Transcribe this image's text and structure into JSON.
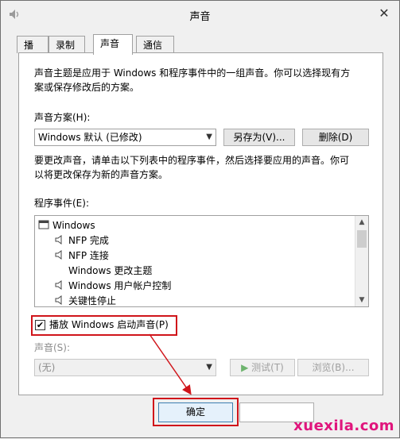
{
  "window": {
    "title": "声音"
  },
  "tabs": [
    {
      "label": "播放",
      "active": false
    },
    {
      "label": "录制",
      "active": false
    },
    {
      "label": "声音",
      "active": true
    },
    {
      "label": "通信",
      "active": false
    }
  ],
  "intro": {
    "line1": "声音主题是应用于 Windows 和程序事件中的一组声音。你可以选择现有方",
    "line2": "案或保存修改后的方案。"
  },
  "scheme": {
    "label": "声音方案(H):",
    "value": "Windows 默认 (已修改)",
    "save_as_label": "另存为(V)...",
    "delete_label": "删除(D)"
  },
  "help": {
    "line1": "要更改声音，请单击以下列表中的程序事件，然后选择要应用的声音。你可",
    "line2": "以将更改保存为新的声音方案。"
  },
  "events": {
    "label": "程序事件(E):",
    "root": "Windows",
    "items": [
      {
        "label": "NFP 完成",
        "has_sound": true
      },
      {
        "label": "NFP 连接",
        "has_sound": true
      },
      {
        "label": "Windows 更改主题",
        "has_sound": false
      },
      {
        "label": "Windows 用户帐户控制",
        "has_sound": true
      },
      {
        "label": "关键性停止",
        "has_sound": true
      }
    ]
  },
  "startup": {
    "label": "播放 Windows 启动声音(P)",
    "checked": true,
    "check_glyph": "✔"
  },
  "sound": {
    "label": "声音(S):",
    "value": "(无)",
    "test_label": "测试(T)",
    "browse_label": "浏览(B)..."
  },
  "footer": {
    "ok_label": "确定"
  },
  "watermark": "xuexila.com",
  "colors": {
    "annotation": "#d0141a",
    "watermark": "#e0157c"
  }
}
